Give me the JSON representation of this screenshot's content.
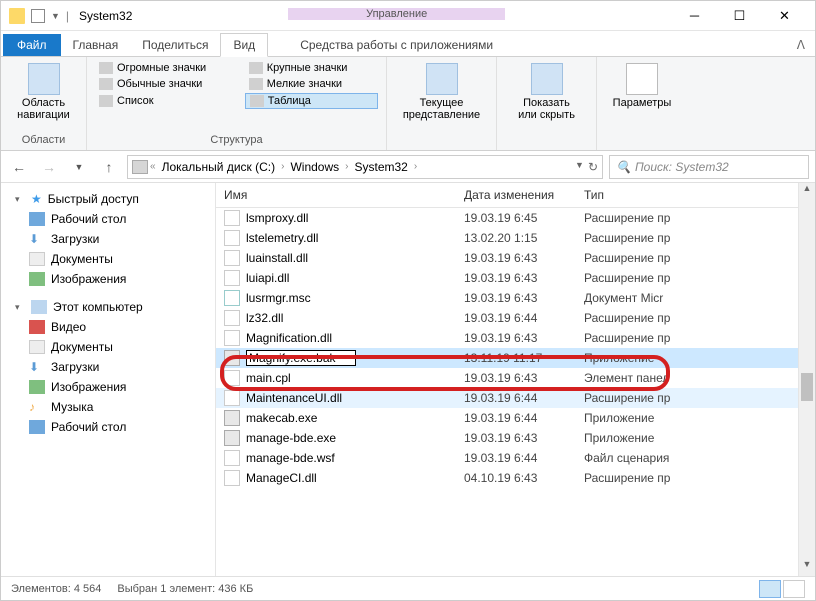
{
  "title": "System32",
  "context_header": "Управление",
  "tabs": {
    "file": "Файл",
    "home": "Главная",
    "share": "Поделиться",
    "view": "Вид",
    "context": "Средства работы с приложениями"
  },
  "ribbon": {
    "nav_panel": "Область\nнавигации",
    "panels_label": "Области",
    "views": {
      "extra_large": "Огромные значки",
      "large": "Крупные значки",
      "medium": "Обычные значки",
      "small": "Мелкие значки",
      "list": "Список",
      "details": "Таблица"
    },
    "structure_label": "Структура",
    "current_view": "Текущее\nпредставление",
    "show_hide": "Показать\nили скрыть",
    "options": "Параметры"
  },
  "breadcrumb": {
    "drive": "Локальный диск (C:)",
    "p1": "Windows",
    "p2": "System32"
  },
  "search_placeholder": "Поиск: System32",
  "nav": {
    "quick": "Быстрый доступ",
    "desktop": "Рабочий стол",
    "downloads": "Загрузки",
    "documents": "Документы",
    "pictures": "Изображения",
    "thispc": "Этот компьютер",
    "video": "Видео",
    "documents2": "Документы",
    "downloads2": "Загрузки",
    "pictures2": "Изображения",
    "music": "Музыка",
    "desktop2": "Рабочий стол"
  },
  "columns": {
    "name": "Имя",
    "date": "Дата изменения",
    "type": "Тип"
  },
  "files": [
    {
      "name": "lsmproxy.dll",
      "date": "19.03.19 6:45",
      "type": "Расширение пр",
      "icon": "dll"
    },
    {
      "name": "lstelemetry.dll",
      "date": "13.02.20 1:15",
      "type": "Расширение пр",
      "icon": "dll"
    },
    {
      "name": "luainstall.dll",
      "date": "19.03.19 6:43",
      "type": "Расширение пр",
      "icon": "dll"
    },
    {
      "name": "luiapi.dll",
      "date": "19.03.19 6:43",
      "type": "Расширение пр",
      "icon": "dll"
    },
    {
      "name": "lusrmgr.msc",
      "date": "19.03.19 6:43",
      "type": "Документ Micr",
      "icon": "msc"
    },
    {
      "name": "lz32.dll",
      "date": "19.03.19 6:44",
      "type": "Расширение пр",
      "icon": "dll"
    },
    {
      "name": "Magnification.dll",
      "date": "19.03.19 6:43",
      "type": "Расширение пр",
      "icon": "dll"
    },
    {
      "name": "Magnify.exe.bak",
      "date": "13.11.19 11:17",
      "type": "Приложение",
      "icon": "exe",
      "selected": true,
      "renaming": true
    },
    {
      "name": "main.cpl",
      "date": "19.03.19 6:43",
      "type": "Элемент панел",
      "icon": "dll"
    },
    {
      "name": "MaintenanceUI.dll",
      "date": "19.03.19 6:44",
      "type": "Расширение пр",
      "icon": "dll",
      "sel2": true
    },
    {
      "name": "makecab.exe",
      "date": "19.03.19 6:44",
      "type": "Приложение",
      "icon": "exe"
    },
    {
      "name": "manage-bde.exe",
      "date": "19.03.19 6:43",
      "type": "Приложение",
      "icon": "exe"
    },
    {
      "name": "manage-bde.wsf",
      "date": "19.03.19 6:44",
      "type": "Файл сценария",
      "icon": "dll"
    },
    {
      "name": "ManageCI.dll",
      "date": "04.10.19 6:43",
      "type": "Расширение пр",
      "icon": "dll"
    }
  ],
  "status": {
    "count": "Элементов: 4 564",
    "selected": "Выбран 1 элемент: 436 КБ"
  }
}
